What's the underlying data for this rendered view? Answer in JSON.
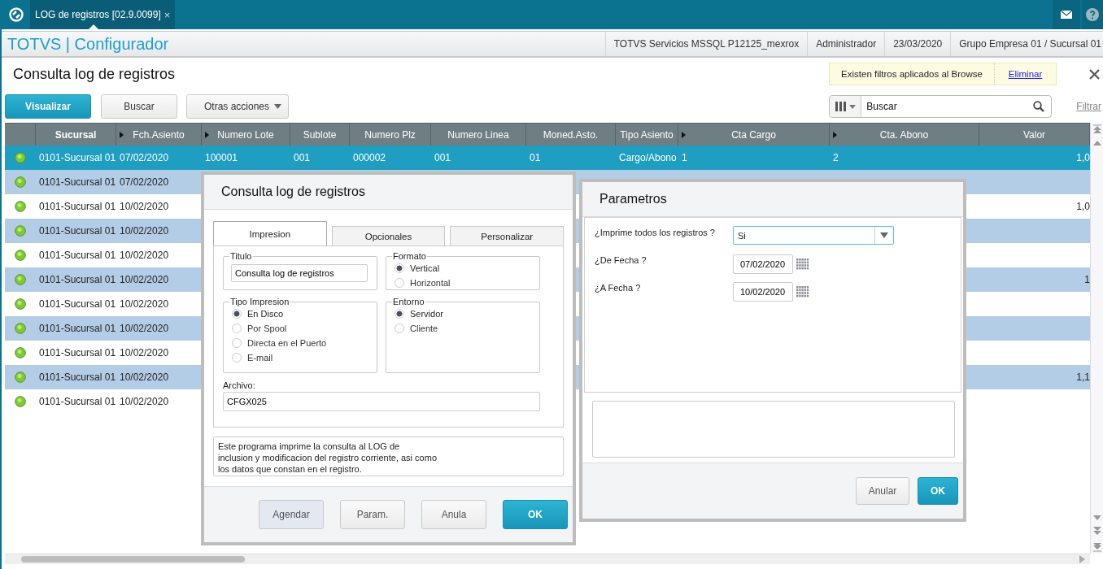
{
  "top_bar": {
    "tab": {
      "label": "LOG de registros [02.9.0099]",
      "close": "×",
      "selected": true
    }
  },
  "header": {
    "brand": "TOTVS | Configurador",
    "info": [
      "TOTVS Servicios MSSQL P12125_mexrox",
      "Administrador",
      "23/03/2020",
      "Grupo Empresa 01 / Sucursal 01"
    ]
  },
  "page_title": "Consulta log de registros",
  "filter_notice": {
    "text": "Existen filtros aplicados al Browse",
    "link": "Eliminar"
  },
  "toolbar": {
    "buttons": [
      {
        "label": "Visualizar",
        "kind": "primary"
      },
      {
        "label": "Buscar",
        "kind": "default"
      },
      {
        "label": "Otras acciones",
        "kind": "menu"
      }
    ]
  },
  "search": {
    "placeholder": "Buscar"
  },
  "filter_link": "Filtrar",
  "table": {
    "columns": [
      {
        "label": "Sucursal",
        "sorted": true,
        "marker": false
      },
      {
        "label": "Fch.Asiento",
        "sorted": false,
        "marker": true
      },
      {
        "label": "Numero Lote",
        "sorted": false,
        "marker": true
      },
      {
        "label": "Sublote",
        "sorted": false,
        "marker": false
      },
      {
        "label": "Numero Plz",
        "sorted": false,
        "marker": false
      },
      {
        "label": "Numero Linea",
        "sorted": false,
        "marker": false
      },
      {
        "label": "Moned.Asto.",
        "sorted": false,
        "marker": false
      },
      {
        "label": "Tipo Asiento",
        "sorted": false,
        "marker": false
      },
      {
        "label": "Cta Cargo",
        "sorted": false,
        "marker": true
      },
      {
        "label": "Cta. Abono",
        "sorted": false,
        "marker": true
      },
      {
        "label": "Valor",
        "sorted": false,
        "marker": false
      }
    ],
    "rows": [
      {
        "selected": true,
        "sucursal": "0101-Sucursal 01",
        "fch_asiento": "07/02/2020",
        "numero_lote": "100001",
        "sublote": "001",
        "numero_plz": "000002",
        "numero_linea": "001",
        "moned_asto": "01",
        "tipo_asiento": "Cargo/Abono",
        "cta_cargo": "1",
        "cta_abono": "2",
        "valor": "1,0"
      },
      {
        "selected": false,
        "sucursal": "0101-Sucursal 01",
        "fch_asiento": "07/02/2020"
      },
      {
        "selected": false,
        "sucursal": "0101-Sucursal 01",
        "fch_asiento": "10/02/2020",
        "valor": "1,0"
      },
      {
        "selected": false,
        "sucursal": "0101-Sucursal 01",
        "fch_asiento": "10/02/2020"
      },
      {
        "selected": false,
        "sucursal": "0101-Sucursal 01",
        "fch_asiento": "10/02/2020"
      },
      {
        "selected": false,
        "sucursal": "0101-Sucursal 01",
        "fch_asiento": "10/02/2020",
        "valor": "1"
      },
      {
        "selected": false,
        "sucursal": "0101-Sucursal 01",
        "fch_asiento": "10/02/2020"
      },
      {
        "selected": false,
        "sucursal": "0101-Sucursal 01",
        "fch_asiento": "10/02/2020"
      },
      {
        "selected": false,
        "sucursal": "0101-Sucursal 01",
        "fch_asiento": "10/02/2020"
      },
      {
        "selected": false,
        "sucursal": "0101-Sucursal 01",
        "fch_asiento": "10/02/2020",
        "valor": "1,1"
      },
      {
        "selected": false,
        "sucursal": "0101-Sucursal 01",
        "fch_asiento": "10/02/2020"
      }
    ]
  },
  "print_dialog": {
    "title": "Consulta log de registros",
    "tabs": [
      {
        "label": "Impresion",
        "selected": true
      },
      {
        "label": "Opcionales",
        "selected": false
      },
      {
        "label": "Personalizar",
        "selected": false
      }
    ],
    "fieldsets": [
      {
        "kind": "text",
        "legend": "Titulo",
        "value": "Consulta log de registros"
      },
      {
        "kind": "radio",
        "legend": "Formato",
        "options": [
          {
            "label": "Vertical",
            "selected": true
          },
          {
            "label": "Horizontal",
            "selected": false
          }
        ]
      },
      {
        "kind": "radio",
        "legend": "Tipo Impresion",
        "options": [
          {
            "label": "En Disco",
            "selected": true
          },
          {
            "label": "Por Spool",
            "selected": false
          },
          {
            "label": "Directa en el Puerto",
            "selected": false
          },
          {
            "label": "E-mail",
            "selected": false
          }
        ]
      },
      {
        "kind": "radio",
        "legend": "Entorno",
        "options": [
          {
            "label": "Servidor",
            "selected": true
          },
          {
            "label": "Cliente",
            "selected": false
          }
        ]
      }
    ],
    "archivo": {
      "label": "Archivo:",
      "value": "CFGX025"
    },
    "description": "Este programa imprime la consulta al LOG de\ninclusion y modificacion del registro corriente, asi como\nlos datos que constan en el registro.",
    "buttons": [
      {
        "label": "Agendar",
        "kind": "highlight"
      },
      {
        "label": "Param.",
        "kind": "default"
      },
      {
        "label": "Anula",
        "kind": "default"
      },
      {
        "label": "OK",
        "kind": "primary"
      }
    ]
  },
  "params_dialog": {
    "title": "Parametros",
    "fields": [
      {
        "kind": "select",
        "label": "¿Imprime todos los registros ?",
        "value": "Si"
      },
      {
        "kind": "date",
        "label": "¿De Fecha ?",
        "value": "07/02/2020"
      },
      {
        "kind": "date",
        "label": "¿A Fecha ?",
        "value": "10/02/2020"
      }
    ],
    "buttons": [
      {
        "label": "Anular",
        "kind": "default"
      },
      {
        "label": "OK",
        "kind": "primary"
      }
    ]
  }
}
